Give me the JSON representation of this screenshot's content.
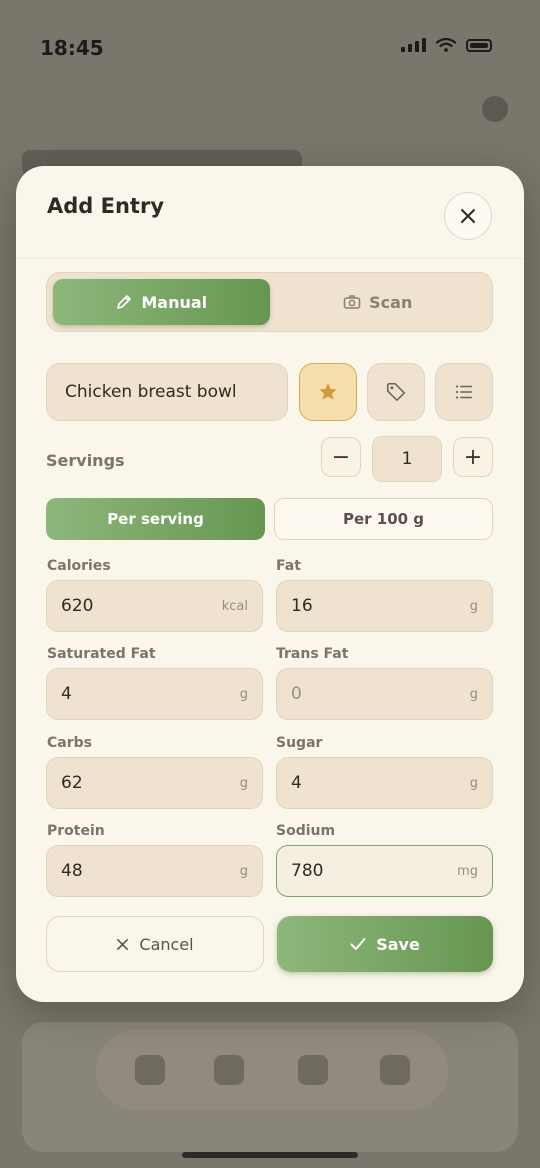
{
  "status_bar": {
    "time": "18:45"
  },
  "modal": {
    "title": "Add Entry",
    "close_icon": "close-icon",
    "mode_tabs": [
      {
        "label": "Manual",
        "icon": "pencil-icon",
        "active": true
      },
      {
        "label": "Scan",
        "icon": "camera-icon",
        "active": false
      }
    ],
    "food_name": {
      "value": "Chicken breast bowl"
    },
    "actions": {
      "favorite_icon": "star-icon",
      "tag_icon": "tag-icon",
      "list_icon": "list-icon"
    },
    "servings": {
      "label": "Servings",
      "minus": "−",
      "value": "1",
      "plus": "+"
    },
    "basis": {
      "per_serving": "Per serving",
      "per_100g": "Per 100 g",
      "selected": "Per serving"
    },
    "nutrients": {
      "calories": {
        "label": "Calories",
        "value": "620",
        "unit": "kcal"
      },
      "fat": {
        "label": "Fat",
        "value": "16",
        "unit": "g"
      },
      "saturated_fat": {
        "label": "Saturated Fat",
        "value": "4",
        "unit": "g"
      },
      "trans_fat": {
        "label": "Trans Fat",
        "value": "0",
        "unit": "g"
      },
      "carbs": {
        "label": "Carbs",
        "value": "62",
        "unit": "g"
      },
      "sugar": {
        "label": "Sugar",
        "value": "4",
        "unit": "g"
      },
      "protein": {
        "label": "Protein",
        "value": "48",
        "unit": "g"
      },
      "sodium": {
        "label": "Sodium",
        "value": "780",
        "unit": "mg"
      }
    },
    "buttons": {
      "cancel": "Cancel",
      "save": "Save"
    }
  },
  "colors": {
    "accent": "#6f9f5a",
    "star": "#d9a95a",
    "surface": "#fbf6ec"
  }
}
